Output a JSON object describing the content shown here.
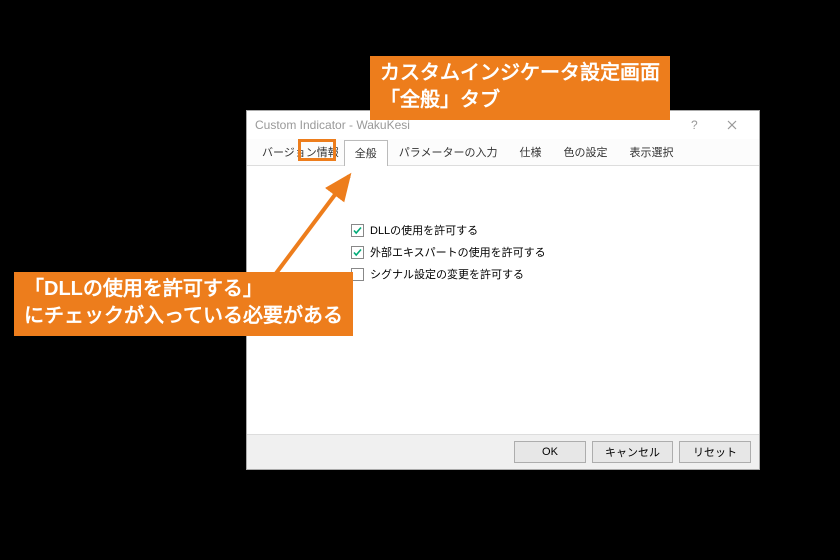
{
  "dialog": {
    "title": "Custom Indicator - WakuKesi",
    "tabs": {
      "version": "バージョン情報",
      "general": "全般",
      "params": "パラメーターの入力",
      "spec": "仕様",
      "colors": "色の設定",
      "display": "表示選択"
    },
    "checks": {
      "allow_dll": "DLLの使用を許可する",
      "allow_ext_experts": "外部エキスパートの使用を許可する",
      "allow_signal_change": "シグナル設定の変更を許可する"
    },
    "buttons": {
      "ok": "OK",
      "cancel": "キャンセル",
      "reset": "リセット"
    }
  },
  "annotations": {
    "top_line1": "カスタムインジケータ設定画面",
    "top_line2": "「全般」タブ",
    "left_line1": "「DLLの使用を許可する」",
    "left_line2": "にチェックが入っている必要がある"
  }
}
